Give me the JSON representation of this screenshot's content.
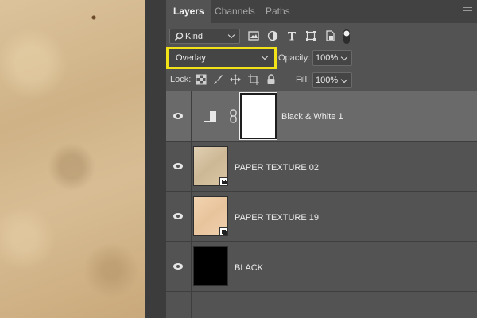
{
  "panel": {
    "tabs": [
      {
        "label": "Layers",
        "active": true
      },
      {
        "label": "Channels",
        "active": false
      },
      {
        "label": "Paths",
        "active": false
      }
    ]
  },
  "filter": {
    "kind_label": "Kind",
    "icons": [
      "pixel-filter-icon",
      "adjustment-filter-icon",
      "type-filter-icon",
      "shape-filter-icon",
      "smart-object-filter-icon",
      "filter-toggle-icon"
    ]
  },
  "blend": {
    "mode": "Overlay",
    "opacity_label": "Opacity:",
    "opacity_value": "100%",
    "highlight_color": "#f2e318"
  },
  "lock": {
    "label": "Lock:",
    "icons": [
      "lock-transparent-pixels-icon",
      "lock-image-pixels-icon",
      "lock-position-icon",
      "lock-artboard-icon",
      "lock-all-icon"
    ],
    "fill_label": "Fill:",
    "fill_value": "100%"
  },
  "layers": [
    {
      "name": "Black & White 1",
      "type": "adjustment",
      "selected": true,
      "visible": true
    },
    {
      "name": "PAPER TEXTURE 02",
      "type": "smart-object",
      "selected": false,
      "visible": true
    },
    {
      "name": "PAPER TEXTURE 19",
      "type": "smart-object",
      "selected": false,
      "visible": true
    },
    {
      "name": "BLACK",
      "type": "pixel",
      "selected": false,
      "visible": true
    }
  ]
}
